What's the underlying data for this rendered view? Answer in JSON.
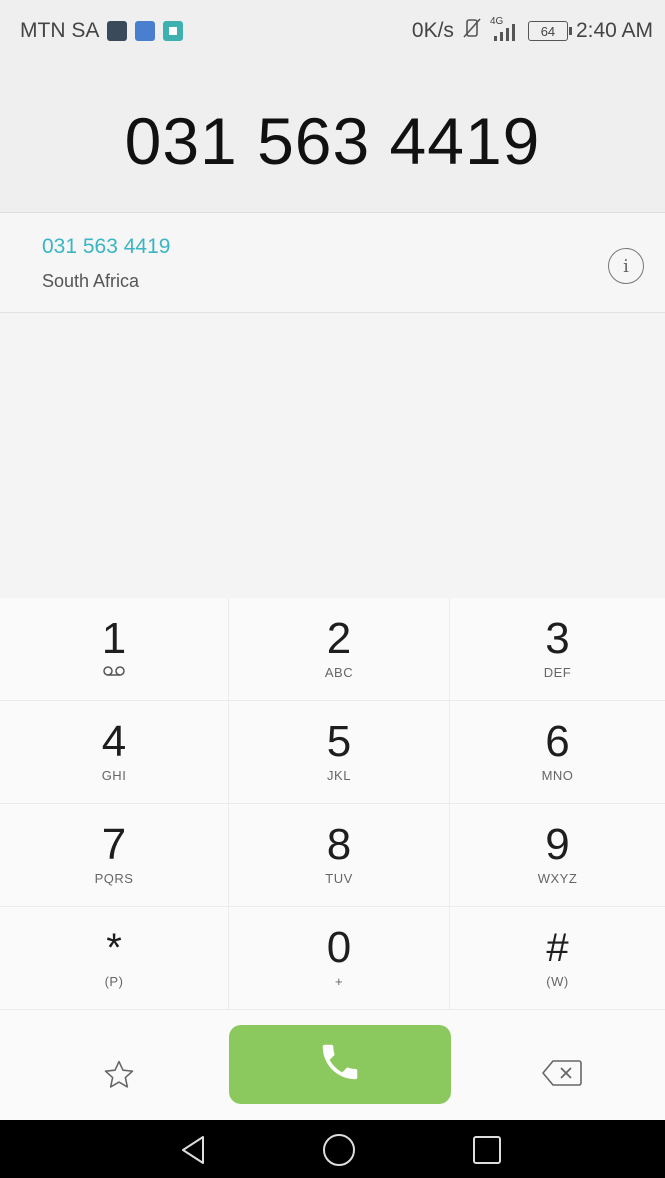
{
  "status_bar": {
    "carrier": "MTN SA",
    "speed": "0K/s",
    "network": "4G",
    "battery": "64",
    "time": "2:40 AM"
  },
  "display": {
    "number": "031 563 4419"
  },
  "suggestion": {
    "number": "031 563 4419",
    "location": "South Africa",
    "info_glyph": "i"
  },
  "keypad": {
    "keys": [
      {
        "digit": "1",
        "letters": ""
      },
      {
        "digit": "2",
        "letters": "ABC"
      },
      {
        "digit": "3",
        "letters": "DEF"
      },
      {
        "digit": "4",
        "letters": "GHI"
      },
      {
        "digit": "5",
        "letters": "JKL"
      },
      {
        "digit": "6",
        "letters": "MNO"
      },
      {
        "digit": "7",
        "letters": "PQRS"
      },
      {
        "digit": "8",
        "letters": "TUV"
      },
      {
        "digit": "9",
        "letters": "WXYZ"
      },
      {
        "digit": "*",
        "letters": "(P)"
      },
      {
        "digit": "0",
        "letters": "+"
      },
      {
        "digit": "#",
        "letters": "(W)"
      }
    ]
  },
  "colors": {
    "accent": "#38b6c4",
    "call_green": "#8bc95e"
  },
  "icons": {
    "voicemail": "voicemail-icon",
    "favorite": "star-outline-icon",
    "call": "phone-icon",
    "delete": "backspace-icon",
    "back": "back-triangle-icon",
    "home": "home-circle-icon",
    "recents": "recents-square-icon"
  }
}
